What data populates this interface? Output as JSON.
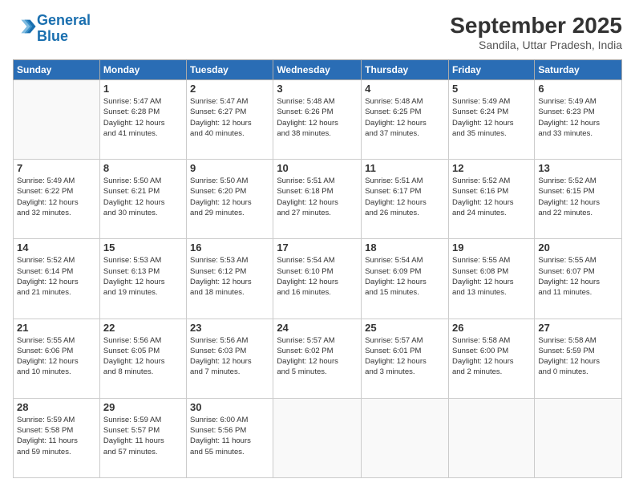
{
  "header": {
    "logo_line1": "General",
    "logo_line2": "Blue",
    "month": "September 2025",
    "location": "Sandila, Uttar Pradesh, India"
  },
  "weekdays": [
    "Sunday",
    "Monday",
    "Tuesday",
    "Wednesday",
    "Thursday",
    "Friday",
    "Saturday"
  ],
  "weeks": [
    [
      {
        "day": "",
        "info": ""
      },
      {
        "day": "1",
        "info": "Sunrise: 5:47 AM\nSunset: 6:28 PM\nDaylight: 12 hours\nand 41 minutes."
      },
      {
        "day": "2",
        "info": "Sunrise: 5:47 AM\nSunset: 6:27 PM\nDaylight: 12 hours\nand 40 minutes."
      },
      {
        "day": "3",
        "info": "Sunrise: 5:48 AM\nSunset: 6:26 PM\nDaylight: 12 hours\nand 38 minutes."
      },
      {
        "day": "4",
        "info": "Sunrise: 5:48 AM\nSunset: 6:25 PM\nDaylight: 12 hours\nand 37 minutes."
      },
      {
        "day": "5",
        "info": "Sunrise: 5:49 AM\nSunset: 6:24 PM\nDaylight: 12 hours\nand 35 minutes."
      },
      {
        "day": "6",
        "info": "Sunrise: 5:49 AM\nSunset: 6:23 PM\nDaylight: 12 hours\nand 33 minutes."
      }
    ],
    [
      {
        "day": "7",
        "info": "Sunrise: 5:49 AM\nSunset: 6:22 PM\nDaylight: 12 hours\nand 32 minutes."
      },
      {
        "day": "8",
        "info": "Sunrise: 5:50 AM\nSunset: 6:21 PM\nDaylight: 12 hours\nand 30 minutes."
      },
      {
        "day": "9",
        "info": "Sunrise: 5:50 AM\nSunset: 6:20 PM\nDaylight: 12 hours\nand 29 minutes."
      },
      {
        "day": "10",
        "info": "Sunrise: 5:51 AM\nSunset: 6:18 PM\nDaylight: 12 hours\nand 27 minutes."
      },
      {
        "day": "11",
        "info": "Sunrise: 5:51 AM\nSunset: 6:17 PM\nDaylight: 12 hours\nand 26 minutes."
      },
      {
        "day": "12",
        "info": "Sunrise: 5:52 AM\nSunset: 6:16 PM\nDaylight: 12 hours\nand 24 minutes."
      },
      {
        "day": "13",
        "info": "Sunrise: 5:52 AM\nSunset: 6:15 PM\nDaylight: 12 hours\nand 22 minutes."
      }
    ],
    [
      {
        "day": "14",
        "info": "Sunrise: 5:52 AM\nSunset: 6:14 PM\nDaylight: 12 hours\nand 21 minutes."
      },
      {
        "day": "15",
        "info": "Sunrise: 5:53 AM\nSunset: 6:13 PM\nDaylight: 12 hours\nand 19 minutes."
      },
      {
        "day": "16",
        "info": "Sunrise: 5:53 AM\nSunset: 6:12 PM\nDaylight: 12 hours\nand 18 minutes."
      },
      {
        "day": "17",
        "info": "Sunrise: 5:54 AM\nSunset: 6:10 PM\nDaylight: 12 hours\nand 16 minutes."
      },
      {
        "day": "18",
        "info": "Sunrise: 5:54 AM\nSunset: 6:09 PM\nDaylight: 12 hours\nand 15 minutes."
      },
      {
        "day": "19",
        "info": "Sunrise: 5:55 AM\nSunset: 6:08 PM\nDaylight: 12 hours\nand 13 minutes."
      },
      {
        "day": "20",
        "info": "Sunrise: 5:55 AM\nSunset: 6:07 PM\nDaylight: 12 hours\nand 11 minutes."
      }
    ],
    [
      {
        "day": "21",
        "info": "Sunrise: 5:55 AM\nSunset: 6:06 PM\nDaylight: 12 hours\nand 10 minutes."
      },
      {
        "day": "22",
        "info": "Sunrise: 5:56 AM\nSunset: 6:05 PM\nDaylight: 12 hours\nand 8 minutes."
      },
      {
        "day": "23",
        "info": "Sunrise: 5:56 AM\nSunset: 6:03 PM\nDaylight: 12 hours\nand 7 minutes."
      },
      {
        "day": "24",
        "info": "Sunrise: 5:57 AM\nSunset: 6:02 PM\nDaylight: 12 hours\nand 5 minutes."
      },
      {
        "day": "25",
        "info": "Sunrise: 5:57 AM\nSunset: 6:01 PM\nDaylight: 12 hours\nand 3 minutes."
      },
      {
        "day": "26",
        "info": "Sunrise: 5:58 AM\nSunset: 6:00 PM\nDaylight: 12 hours\nand 2 minutes."
      },
      {
        "day": "27",
        "info": "Sunrise: 5:58 AM\nSunset: 5:59 PM\nDaylight: 12 hours\nand 0 minutes."
      }
    ],
    [
      {
        "day": "28",
        "info": "Sunrise: 5:59 AM\nSunset: 5:58 PM\nDaylight: 11 hours\nand 59 minutes."
      },
      {
        "day": "29",
        "info": "Sunrise: 5:59 AM\nSunset: 5:57 PM\nDaylight: 11 hours\nand 57 minutes."
      },
      {
        "day": "30",
        "info": "Sunrise: 6:00 AM\nSunset: 5:56 PM\nDaylight: 11 hours\nand 55 minutes."
      },
      {
        "day": "",
        "info": ""
      },
      {
        "day": "",
        "info": ""
      },
      {
        "day": "",
        "info": ""
      },
      {
        "day": "",
        "info": ""
      }
    ]
  ]
}
